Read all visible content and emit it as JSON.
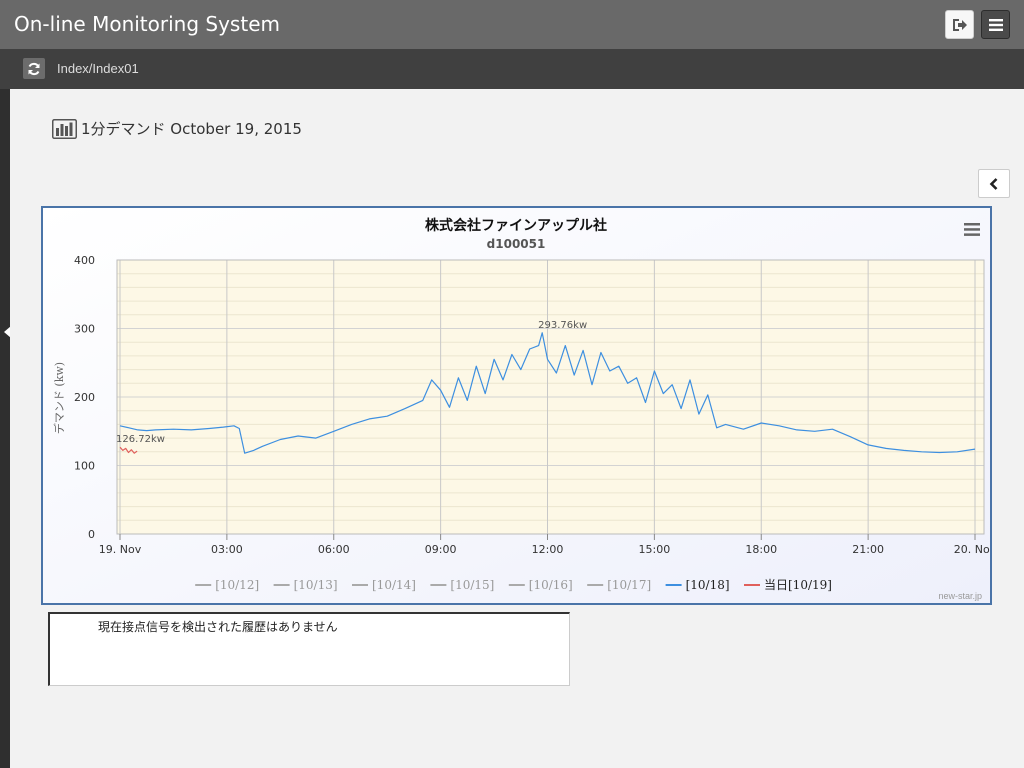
{
  "app": {
    "title": "On-line Monitoring System"
  },
  "header": {
    "logout_icon": "sign-out-icon",
    "menu_icon": "hamburger-icon"
  },
  "subbar": {
    "refresh_icon": "refresh-icon",
    "breadcrumb": "Index/Index01"
  },
  "page": {
    "heading_icon": "bar-chart-icon",
    "heading": "1分デマンド October 19, 2015",
    "collapse_icon": "chevron-left-icon"
  },
  "chart_data": {
    "type": "line",
    "title": "株式会社ファインアップル社",
    "subtitle": "d100051",
    "ylabel": "デマンド (kw)",
    "xlabel": "",
    "ylim": [
      0,
      400
    ],
    "yticks": [
      "0",
      "100",
      "200",
      "300",
      "400"
    ],
    "xlim_hours": [
      0,
      24
    ],
    "xticks": [
      "19. Nov",
      "03:00",
      "06:00",
      "09:00",
      "12:00",
      "15:00",
      "18:00",
      "21:00",
      "20. Nov"
    ],
    "grid": true,
    "legend_position": "bottom",
    "credit": "new-star.jp",
    "series": [
      {
        "name": "[10/12]",
        "color": "#aaaaaa",
        "x": [],
        "y": []
      },
      {
        "name": "[10/13]",
        "color": "#aaaaaa",
        "x": [],
        "y": []
      },
      {
        "name": "[10/14]",
        "color": "#aaaaaa",
        "x": [],
        "y": []
      },
      {
        "name": "[10/15]",
        "color": "#aaaaaa",
        "x": [],
        "y": []
      },
      {
        "name": "[10/16]",
        "color": "#aaaaaa",
        "x": [],
        "y": []
      },
      {
        "name": "[10/17]",
        "color": "#aaaaaa",
        "x": [],
        "y": []
      },
      {
        "name": "[10/18]",
        "color": "#3d8fe0",
        "x": [
          0,
          0.25,
          0.5,
          0.75,
          1,
          1.5,
          2,
          2.5,
          2.9,
          3.2,
          3.35,
          3.5,
          3.75,
          4,
          4.5,
          5,
          5.5,
          6,
          6.5,
          7,
          7.5,
          8,
          8.5,
          8.75,
          9,
          9.25,
          9.5,
          9.75,
          10,
          10.25,
          10.5,
          10.75,
          11,
          11.25,
          11.5,
          11.75,
          11.85,
          12,
          12.25,
          12.5,
          12.75,
          13,
          13.25,
          13.5,
          13.75,
          14,
          14.25,
          14.5,
          14.75,
          15,
          15.25,
          15.5,
          15.75,
          16,
          16.25,
          16.5,
          16.75,
          17,
          17.5,
          18,
          18.5,
          19,
          19.5,
          20,
          20.5,
          21,
          21.5,
          22,
          22.5,
          23,
          23.5,
          24
        ],
        "y": [
          158,
          155,
          152,
          151,
          152,
          153,
          152,
          154,
          156,
          158,
          154,
          118,
          122,
          128,
          138,
          143,
          140,
          150,
          160,
          168,
          172,
          183,
          195,
          225,
          210,
          185,
          228,
          195,
          245,
          205,
          255,
          225,
          262,
          240,
          270,
          275,
          293.76,
          255,
          235,
          275,
          232,
          268,
          218,
          265,
          238,
          245,
          220,
          228,
          192,
          238,
          205,
          218,
          183,
          225,
          175,
          203,
          155,
          160,
          153,
          162,
          158,
          152,
          150,
          153,
          142,
          130,
          125,
          122,
          120,
          119,
          120,
          124
        ]
      },
      {
        "name": "当日[10/19]",
        "color": "#e0605c",
        "x": [
          0,
          0.08,
          0.16,
          0.24,
          0.32,
          0.4,
          0.48
        ],
        "y": [
          126.72,
          122,
          125,
          119,
          123,
          118,
          121
        ]
      }
    ],
    "annotations": [
      {
        "series": "[10/18]",
        "x": 11.85,
        "y": 293.76,
        "text": "293.76kw"
      },
      {
        "series": "当日[10/19]",
        "x": 0,
        "y": 126.72,
        "text": "126.72kw"
      }
    ]
  },
  "contact_log": {
    "message": "現在接点信号を検出された履歴はありません"
  }
}
